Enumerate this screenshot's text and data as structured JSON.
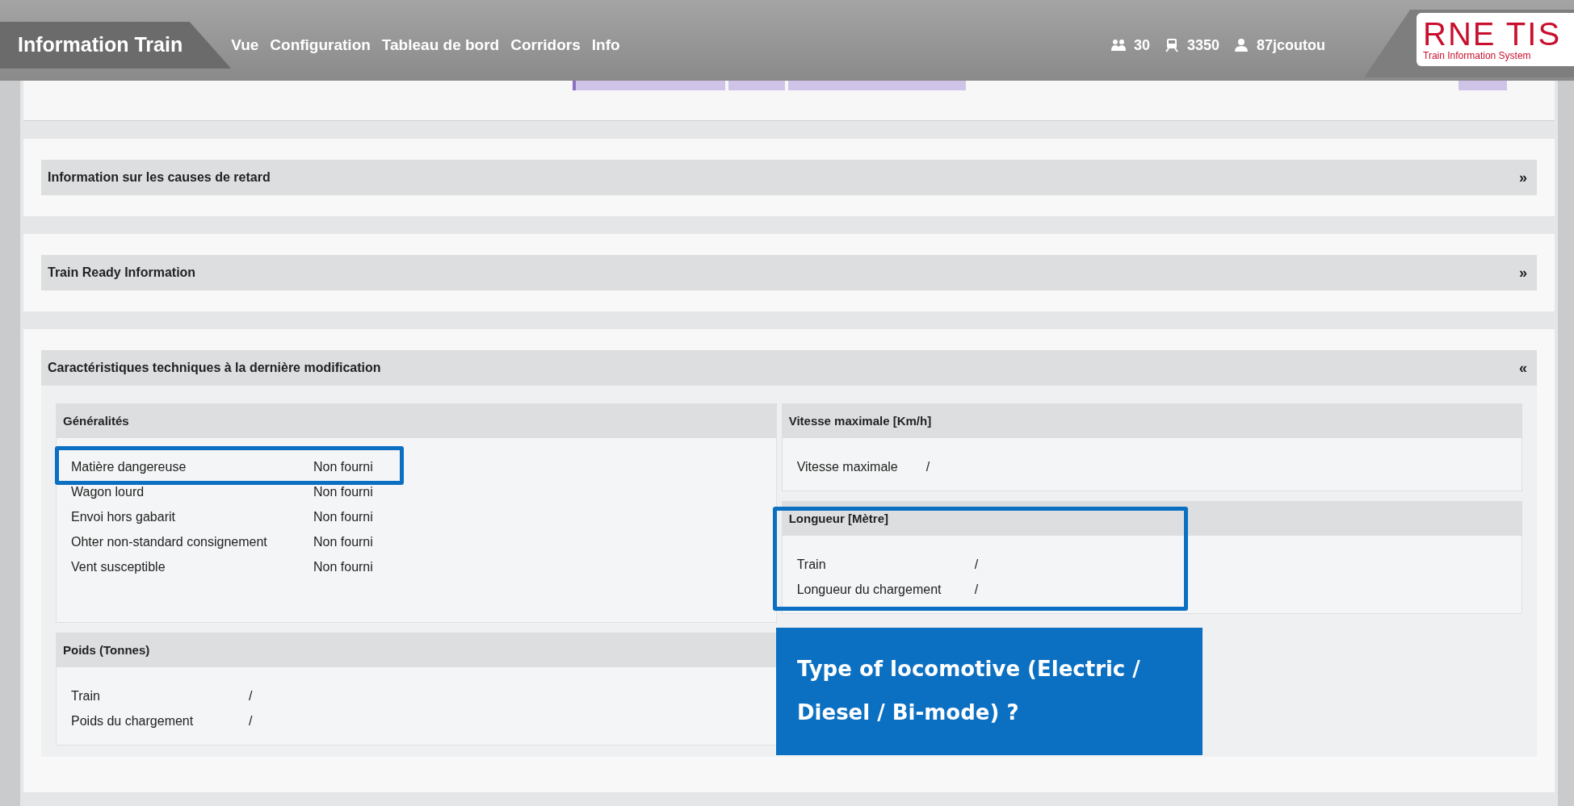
{
  "header": {
    "title": "Information Train",
    "nav": [
      "Vue",
      "Configuration",
      "Tableau de bord",
      "Corridors",
      "Info"
    ],
    "stats": [
      {
        "kind": "users",
        "text": "30"
      },
      {
        "kind": "train",
        "text": "3350"
      },
      {
        "kind": "user",
        "text": "87jcoutou"
      }
    ],
    "logo": {
      "wordmark": "RNE TIS",
      "subtitle": "Train Information System"
    }
  },
  "panels": [
    {
      "title": "Information sur les causes de retard",
      "toggle": "»",
      "expanded": false
    },
    {
      "title": "Train Ready Information",
      "toggle": "»",
      "expanded": false
    },
    {
      "title": "Caractéristiques techniques à la dernière modification",
      "toggle": "«",
      "expanded": true,
      "columns": [
        [
          {
            "title": "Généralités",
            "rows": [
              [
                "Matière dangereuse",
                "Non fourni"
              ],
              [
                "Wagon lourd",
                "Non fourni"
              ],
              [
                "Envoi hors gabarit",
                "Non fourni"
              ],
              [
                "Ohter non-standard consignement",
                "Non fourni"
              ],
              [
                "Vent susceptible",
                "Non fourni"
              ]
            ]
          },
          {
            "title": "Poids (Tonnes)",
            "rows": [
              [
                "Train",
                "/"
              ],
              [
                "Poids du chargement",
                "/"
              ]
            ]
          }
        ],
        [
          {
            "title": "Vitesse maximale [Km/h]",
            "rows": [
              [
                "Vitesse maximale",
                "/"
              ]
            ]
          },
          {
            "title": "Longueur [Mètre]",
            "rows": [
              [
                "Train",
                "/"
              ],
              [
                "Longueur du chargement",
                "/"
              ]
            ]
          }
        ]
      ]
    }
  ],
  "annotation": {
    "callout": "Type of locomotive (Electric / Diesel / Bi-mode) ?"
  }
}
